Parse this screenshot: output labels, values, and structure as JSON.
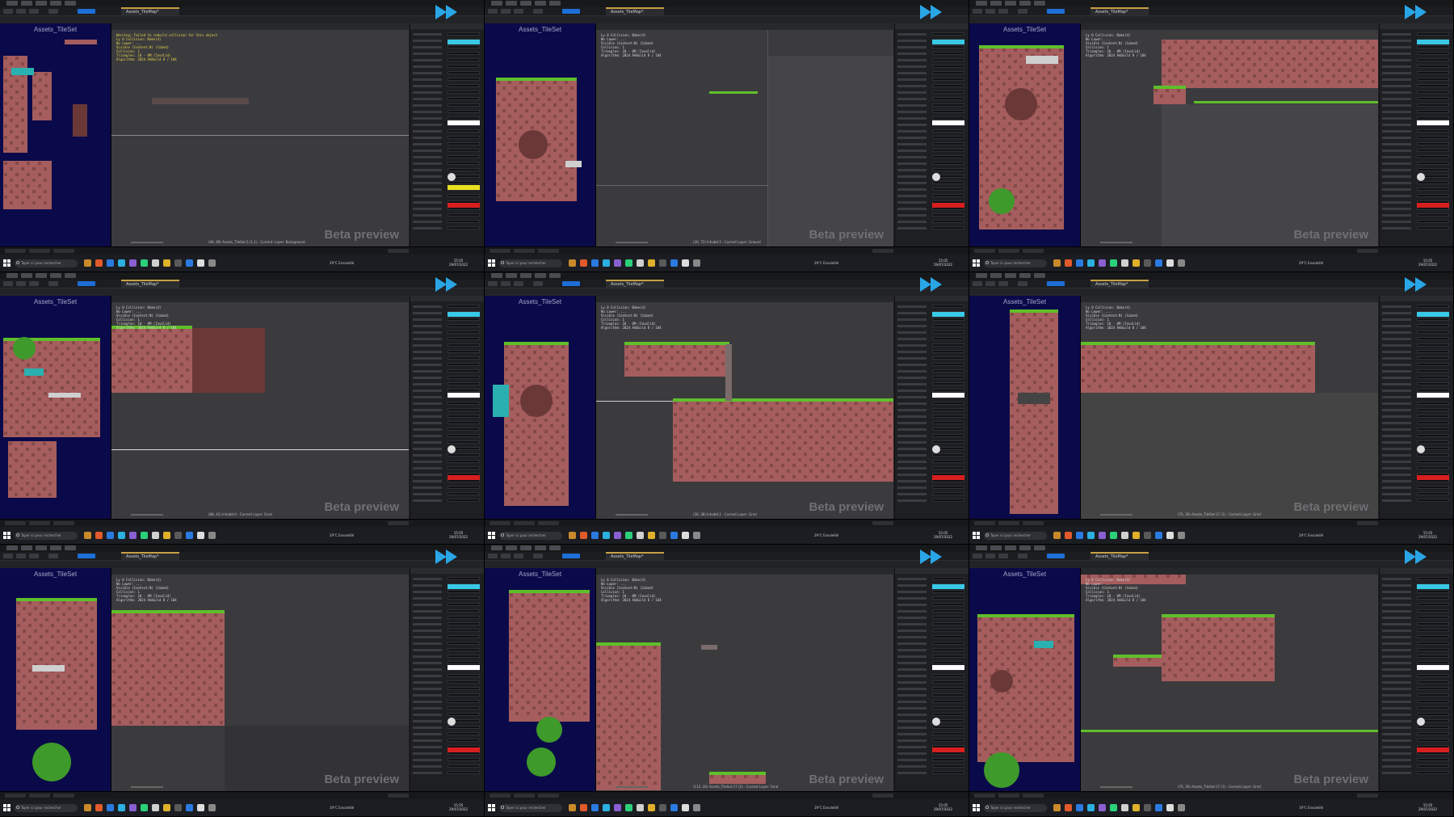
{
  "montage": {
    "panels": [
      {
        "id": 1,
        "tileset_title": "Assets_TileSet",
        "tab": "Assets_TileMap*",
        "status": "(96, 89) Assets_TileSet:3 (1,1) - Current: Layer: Background",
        "weather": "29°C Ensoleillé",
        "warning": "Warning: Failed to rebuild collision for this object"
      },
      {
        "id": 2,
        "tileset_title": "Assets_TileSet",
        "tab": "Assets_TileMap*",
        "status": "(36, 72) Inhabit:2 - Current Layer: Ground",
        "weather": "29°C Ensoleillé",
        "warning": ""
      },
      {
        "id": 3,
        "tileset_title": "Assets_TileSet",
        "tab": "Assets_TileMap*",
        "status": "",
        "weather": "29°C Ensoleillé",
        "warning": ""
      },
      {
        "id": 4,
        "tileset_title": "Assets_TileSet",
        "tab": "Assets_TileMap*",
        "status": "(88, 42) Inhabit:0 - Current Layer: Grnd",
        "weather": "29°C Ensoleillé",
        "warning": ""
      },
      {
        "id": 5,
        "tileset_title": "Assets_TileSet",
        "tab": "Assets_TileMap*",
        "status": "(36, 38) Inhabit:2 - Current Layer: Grnd",
        "weather": "29°C Ensoleillé",
        "warning": ""
      },
      {
        "id": 6,
        "tileset_title": "Assets_TileSet",
        "tab": "Assets_TileMap*",
        "status": "(76, 30) Assets_TileSet:17 (1) - Current Layer: Grnd",
        "weather": "29°C Ensoleillé",
        "warning": ""
      },
      {
        "id": 7,
        "tileset_title": "Assets_TileSet",
        "tab": "Assets_TileMap*",
        "status": "",
        "weather": "19°C Ensoleillé",
        "warning": ""
      },
      {
        "id": 8,
        "tileset_title": "Assets_TileSet",
        "tab": "Assets_TileMap*",
        "status": "(113, 26) Assets_TileSet:17 (2) - Current Layer: Grnd",
        "weather": "19°C Ensoleillé",
        "warning": ""
      },
      {
        "id": 9,
        "tileset_title": "Assets_TileSet",
        "tab": "Assets_TileMap*",
        "status": "(76, 26) Assets_TileSet:17 (1) - Current Layer: Grnd",
        "weather": "19°C Ensoleillé",
        "warning": ""
      }
    ],
    "common": {
      "beta_label": "Beta preview",
      "search_placeholder": "Taper ici pour rechercher",
      "stats": "Ly 0 Collision: Bake(4)\nNo Lower: ...\nVisible (Content:N) (Cubed)\nCollision: 1\nTriangles: 10 - 0M (Invalid)\nAlgorithm: 2024 AkBuild 8 / 104",
      "time": "15:05",
      "date": "29/07/2022"
    },
    "colors": {
      "tileset_bg": "#0a0a4a",
      "grass": "#5fbf2a",
      "rock": "#a55d5d",
      "rock_dark": "#6b3838",
      "viewport": "#3b3b3e",
      "accent_blue": "#1d6fd8",
      "logo_blue": "#2aa6e6"
    },
    "icons": [
      "fast-forward-logo-icon",
      "search-icon",
      "windows-start-icon",
      "weather-icon"
    ]
  }
}
